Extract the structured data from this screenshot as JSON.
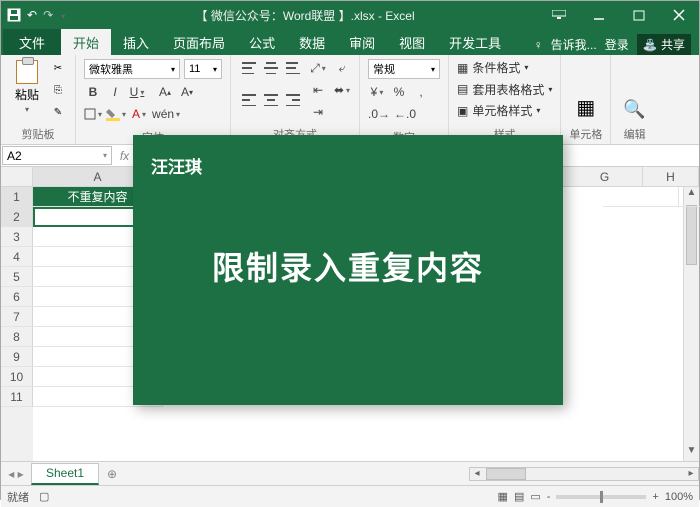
{
  "title": "【 微信公众号：Word联盟 】.xlsx - Excel",
  "tabs": {
    "file": "文件",
    "home": "开始",
    "insert": "插入",
    "layout": "页面布局",
    "formula": "公式",
    "data": "数据",
    "review": "审阅",
    "view": "视图",
    "dev": "开发工具",
    "tell": "告诉我...",
    "login": "登录",
    "share": "共享"
  },
  "ribbon": {
    "clipboard": {
      "paste": "粘贴",
      "title": "剪贴板"
    },
    "font": {
      "name": "微软雅黑",
      "size": "11",
      "title": "字体",
      "wen": "wén",
      "B": "B",
      "I": "I",
      "U": "U"
    },
    "align": {
      "title": "对齐方式"
    },
    "number": {
      "general": "常规",
      "title": "数字"
    },
    "styles": {
      "cond": "条件格式",
      "tbl": "套用表格格式",
      "cell": "单元格样式",
      "title": "样式"
    },
    "cells": {
      "title": "单元格"
    },
    "editing": {
      "title": "编辑"
    }
  },
  "namebox": "A2",
  "columns": [
    "A",
    "G",
    "H"
  ],
  "rows": [
    "1",
    "2",
    "3",
    "4",
    "5",
    "6",
    "7",
    "8",
    "9",
    "10",
    "11"
  ],
  "cellA1": "不重复内容",
  "sheet_tab": "Sheet1",
  "status": {
    "ready": "就绪",
    "zoom": "100%",
    "plus": "+",
    "minus": "-"
  },
  "overlay": {
    "logo": "汪汪琪",
    "headline": "限制录入重复内容"
  }
}
